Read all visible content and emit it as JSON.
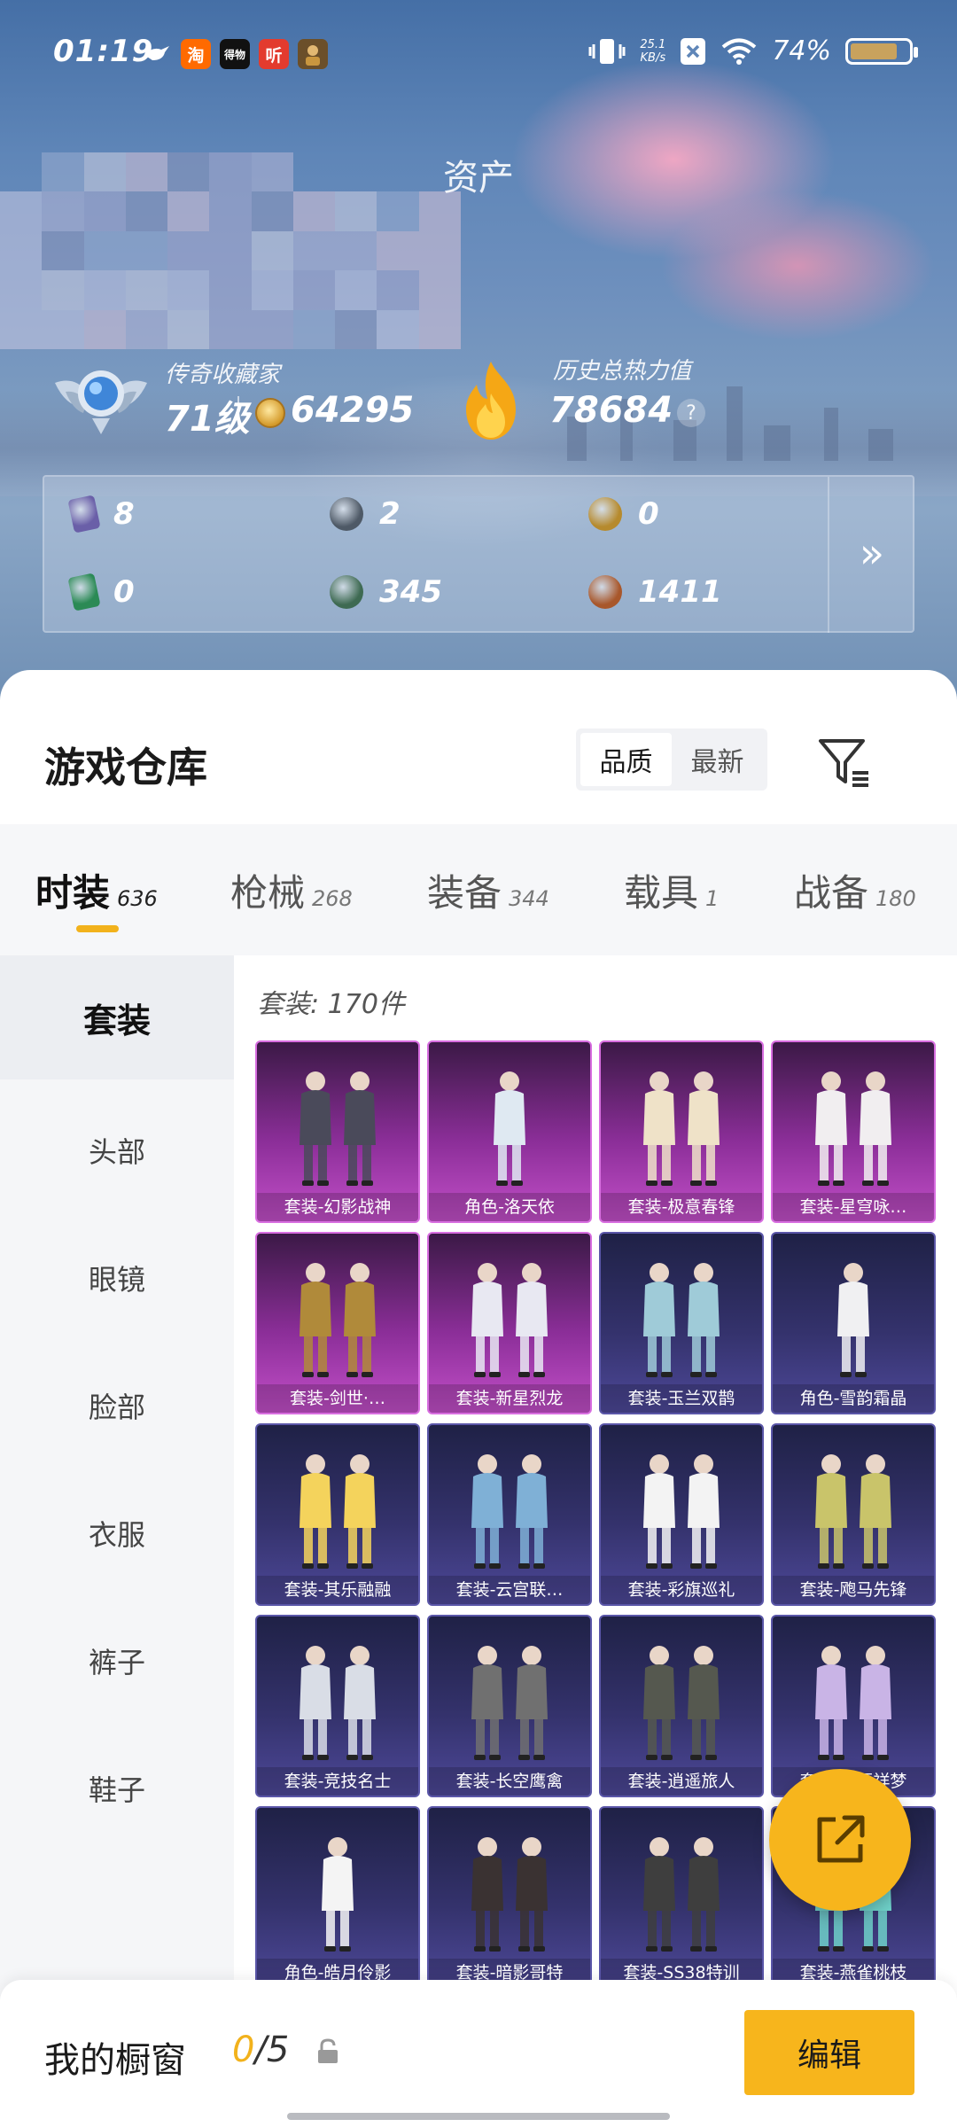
{
  "status_bar": {
    "time": "01:19",
    "apps": [
      {
        "icon": "bird-icon",
        "label": "",
        "color": "transparent"
      },
      {
        "icon": "taobao-icon",
        "label": "淘",
        "color": "#ff6a00"
      },
      {
        "icon": "dewu-icon",
        "label": "得物",
        "color": "#111111"
      },
      {
        "icon": "listen-icon",
        "label": "听",
        "color": "#e33b2e"
      },
      {
        "icon": "game-icon",
        "label": "",
        "color": "#8a6a3a"
      }
    ],
    "net_speed": "25.1",
    "net_unit": "KB/s",
    "battery": "74%"
  },
  "hero": {
    "title": "资产",
    "collector_label": "传奇收藏家",
    "level": "71级",
    "coins": "64295",
    "heat_label": "历史总热力值",
    "heat_value": "78684",
    "help": "?"
  },
  "resources": [
    {
      "icon": "card-icon",
      "value": "8",
      "color": "#6a5fa8"
    },
    {
      "icon": "silver-token-icon",
      "value": "2",
      "color": "#4e5966"
    },
    {
      "icon": "gold-token-icon",
      "value": "0",
      "color": "#b68a2d"
    },
    {
      "icon": "green-card-icon",
      "value": "0",
      "color": "#2b8a55"
    },
    {
      "icon": "green-coin-icon",
      "value": "345",
      "color": "#3e6a52"
    },
    {
      "icon": "bronze-coin-icon",
      "value": "1411",
      "color": "#a8572b"
    }
  ],
  "sheet": {
    "title": "游戏仓库",
    "sort_options": [
      "品质",
      "最新"
    ],
    "sort_active": 0
  },
  "tabs": [
    {
      "name": "时装",
      "count": "636"
    },
    {
      "name": "枪械",
      "count": "268"
    },
    {
      "name": "装备",
      "count": "344"
    },
    {
      "name": "载具",
      "count": "1"
    },
    {
      "name": "战备",
      "count": "180"
    }
  ],
  "side_categories": [
    "套装",
    "头部",
    "眼镜",
    "脸部",
    "衣服",
    "裤子",
    "鞋子"
  ],
  "count_label": "套装: 170件",
  "items": [
    {
      "label": "套装-幻影战神",
      "rarity": "purple",
      "color": "#4a4a5a"
    },
    {
      "label": "角色-洛天依",
      "rarity": "purple",
      "color": "#dfe9f2"
    },
    {
      "label": "套装-极意春锋",
      "rarity": "purple",
      "color": "#efe2c8"
    },
    {
      "label": "套装-星穹咏…",
      "rarity": "purple",
      "color": "#f1eef0"
    },
    {
      "label": "套装-剑世·…",
      "rarity": "purple",
      "color": "#b08a3a"
    },
    {
      "label": "套装-新星烈龙",
      "rarity": "purple",
      "color": "#e8e8f2"
    },
    {
      "label": "套装-玉兰双鹊",
      "rarity": "blue",
      "color": "#9fcbd8"
    },
    {
      "label": "角色-雪韵霜晶",
      "rarity": "blue",
      "color": "#f0f0f2"
    },
    {
      "label": "套装-其乐融融",
      "rarity": "blue",
      "color": "#f4d35c"
    },
    {
      "label": "套装-云宫联…",
      "rarity": "blue",
      "color": "#7fb0d6"
    },
    {
      "label": "套装-彩旗巡礼",
      "rarity": "blue",
      "color": "#f3f3f3"
    },
    {
      "label": "套装-飑马先锋",
      "rarity": "blue",
      "color": "#c9c46a"
    },
    {
      "label": "套装-竞技名士",
      "rarity": "blue",
      "color": "#d9dde6"
    },
    {
      "label": "套装-长空鹰禽",
      "rarity": "blue",
      "color": "#707070"
    },
    {
      "label": "套装-逍遥旅人",
      "rarity": "blue",
      "color": "#55584f"
    },
    {
      "label": "套装-星辰祥梦",
      "rarity": "blue",
      "color": "#c9b4e6"
    },
    {
      "label": "角色-皓月伶影",
      "rarity": "blue",
      "color": "#f4f4f4"
    },
    {
      "label": "套装-暗影哥特",
      "rarity": "blue",
      "color": "#3a3232"
    },
    {
      "label": "套装-SS38特训",
      "rarity": "blue",
      "color": "#3e3e3e"
    },
    {
      "label": "套装-燕雀桃枝",
      "rarity": "blue",
      "color": "#6fd1c9"
    }
  ],
  "bottom": {
    "window_label": "我的橱窗",
    "window_current": "0",
    "window_total": "/5",
    "edit_label": "编辑"
  },
  "colors": {
    "accent": "#f7b51c",
    "purple_card": "#8b2e98",
    "blue_card": "#34326c"
  }
}
